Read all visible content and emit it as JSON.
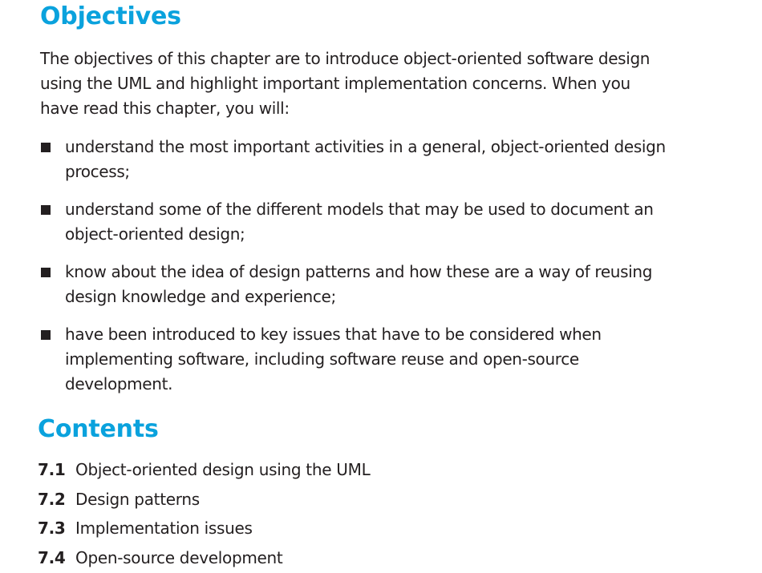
{
  "objectives": {
    "heading": "Objectives",
    "intro": "The objectives of this chapter are to introduce object-oriented software design using the UML and highlight important implementation concerns. When you have read this chapter, you will:",
    "bullets": [
      "understand the most important activities in a general, object-oriented design process;",
      "understand some of the different models that may be used to document an object-oriented design;",
      "know about the idea of design patterns and how these are a way of reusing design knowledge and experience;",
      "have been introduced to key issues that have to be considered when implementing software, including software reuse and open-source development."
    ]
  },
  "contents": {
    "heading": "Contents",
    "items": [
      {
        "number": "7.1",
        "title": "Object-oriented design using the UML"
      },
      {
        "number": "7.2",
        "title": "Design patterns"
      },
      {
        "number": "7.3",
        "title": "Implementation issues"
      },
      {
        "number": "7.4",
        "title": "Open-source development"
      }
    ]
  },
  "colors": {
    "heading": "#0aa2dd",
    "text": "#231f20",
    "background": "#ffffff"
  }
}
